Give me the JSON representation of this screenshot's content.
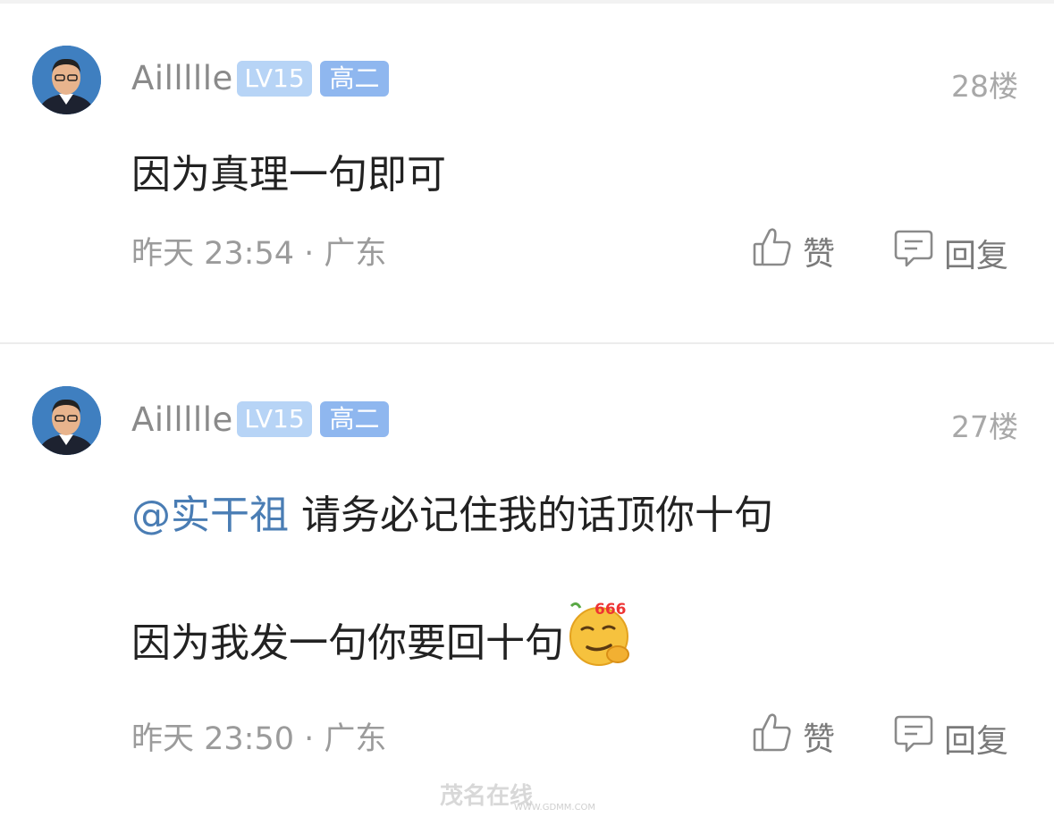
{
  "comments": [
    {
      "username": "Aillllle",
      "level_badge": "LV15",
      "grade_badge": "高二",
      "floor": "28楼",
      "lines": [
        "因为真理一句即可"
      ],
      "mention": "",
      "time": "昨天 23:54 · 广东",
      "like_label": "赞",
      "reply_label": "回复"
    },
    {
      "username": "Aillllle",
      "level_badge": "LV15",
      "grade_badge": "高二",
      "floor": "27楼",
      "mention": "@实干祖",
      "lines": [
        "请务必记住我的话顶你十句",
        "因为我发一句你要回十句"
      ],
      "emoji_text": "666",
      "time": "昨天 23:50 · 广东",
      "like_label": "赞",
      "reply_label": "回复"
    }
  ],
  "watermark": {
    "text": "茂名在线",
    "url": "WWW.GDMM.COM"
  },
  "colors": {
    "badge_level": "#b7d4f6",
    "badge_grade": "#8fb7ef",
    "mention": "#4a7db4"
  },
  "icons": [
    "thumbs-up-icon",
    "comment-bubble-icon",
    "smirk-emoji-icon"
  ]
}
